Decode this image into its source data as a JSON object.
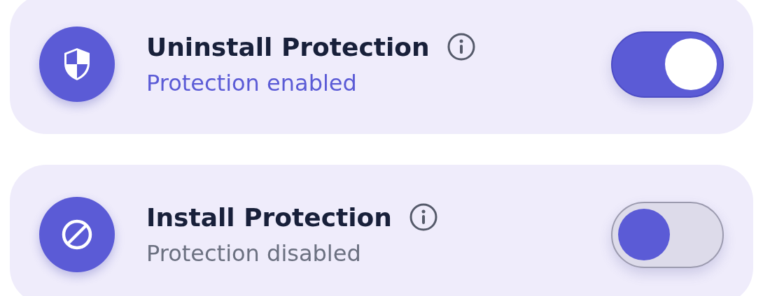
{
  "settings": [
    {
      "title": "Uninstall Protection",
      "status": "Protection enabled",
      "on": true
    },
    {
      "title": "Install Protection",
      "status": "Protection disabled",
      "on": false
    }
  ]
}
